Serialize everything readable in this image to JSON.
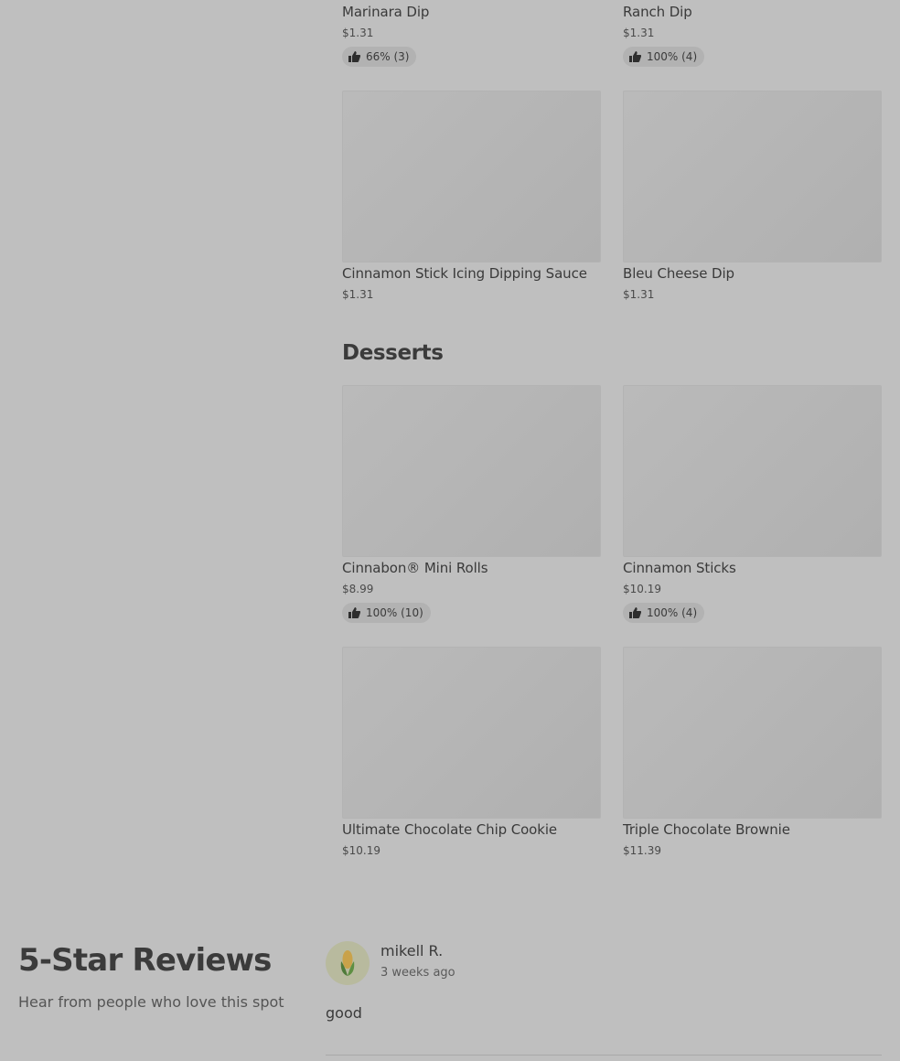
{
  "sauces": [
    {
      "name": "Marinara Dip",
      "price": "$1.31",
      "rating": "66% (3)"
    },
    {
      "name": "Ranch Dip",
      "price": "$1.31",
      "rating": "100% (4)"
    },
    {
      "name": "Cinnamon Stick Icing Dipping Sauce",
      "price": "$1.31"
    },
    {
      "name": "Bleu Cheese Dip",
      "price": "$1.31"
    }
  ],
  "desserts": {
    "title": "Desserts",
    "items": [
      {
        "name": "Cinnabon® Mini Rolls",
        "price": "$8.99",
        "rating": "100% (10)"
      },
      {
        "name": "Cinnamon Sticks",
        "price": "$10.19",
        "rating": "100% (4)"
      },
      {
        "name": "Ultimate Chocolate Chip Cookie",
        "price": "$10.19"
      },
      {
        "name": "Triple Chocolate Brownie",
        "price": "$11.39"
      }
    ]
  },
  "reviews": {
    "title": "5-Star Reviews",
    "subtitle": "Hear from people who love this spot",
    "items": [
      {
        "reviewer": "mikell R.",
        "time": "3 weeks ago",
        "text": "good",
        "avatar_icon": "corn-icon"
      }
    ]
  },
  "icons": {
    "rating": "thumbs-up-icon"
  }
}
